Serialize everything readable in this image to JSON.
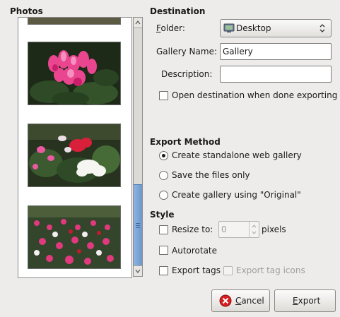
{
  "photos": {
    "label": "Photos",
    "thumbnails": [
      {
        "name": "photo-1-partial"
      },
      {
        "name": "photo-pink-cyclamen"
      },
      {
        "name": "photo-white-red-cyclamen"
      },
      {
        "name": "photo-mixed-cyclamen-bed"
      }
    ]
  },
  "destination": {
    "heading": "Destination",
    "folder_label": "Folder:",
    "folder_value": "Desktop",
    "gallery_name_label": "Gallery Name:",
    "gallery_name_value": "Gallery",
    "description_label": "Description:",
    "description_value": "",
    "open_when_done_label": "Open destination when done exporting",
    "open_when_done_checked": false
  },
  "export_method": {
    "heading": "Export Method",
    "options": [
      {
        "label": "Create standalone web gallery",
        "selected": true
      },
      {
        "label": "Save the files only",
        "selected": false
      },
      {
        "label": "Create gallery using \"Original\"",
        "selected": false
      }
    ]
  },
  "style": {
    "heading": "Style",
    "resize_label": "Resize to:",
    "resize_value": "0",
    "resize_unit": "pixels",
    "autorotate_label": "Autorotate",
    "export_tags_label": "Export tags",
    "export_tag_icons_label": "Export tag icons"
  },
  "buttons": {
    "cancel": "Cancel",
    "export": "Export"
  },
  "colors": {
    "window_bg": "#edeceb",
    "scroll_thumb": "#7aa3d6",
    "cancel_icon": "#d81e1e"
  }
}
